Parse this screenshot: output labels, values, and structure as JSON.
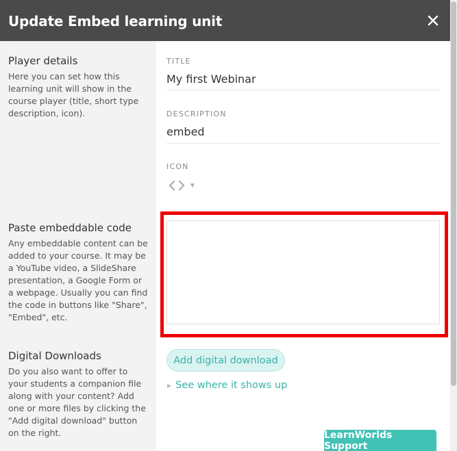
{
  "header": {
    "title": "Update Embed learning unit",
    "close_icon": "close-icon"
  },
  "player_details": {
    "title": "Player details",
    "description": "Here you can set how this learning unit will show in the course player (title, short type description, icon)."
  },
  "fields": {
    "title_label": "TITLE",
    "title_value": "My first Webinar",
    "description_label": "DESCRIPTION",
    "description_value": "embed",
    "icon_label": "ICON",
    "icon_name": "code-icon"
  },
  "embed": {
    "title": "Paste embeddable code",
    "description": "Any embeddable content can be added to your course. It may be a YouTube video, a SlideShare presentation, a Google Form or a webpage. Usually you can find the code in buttons like \"Share\", \"Embed\", etc.",
    "code_value": ""
  },
  "downloads": {
    "title": "Digital Downloads",
    "description": "Do you also want to offer to your students a companion file along with your content? Add one or more files by clicking the \"Add digital download\" button on the right.",
    "add_button": "Add digital download",
    "see_link": "See where it shows up"
  },
  "support": {
    "label": "LearnWorlds Support"
  },
  "colors": {
    "header_bg": "#4a4a4a",
    "accent": "#39b2a7",
    "support_bg": "#42c2b5",
    "highlight": "#ee0000"
  }
}
